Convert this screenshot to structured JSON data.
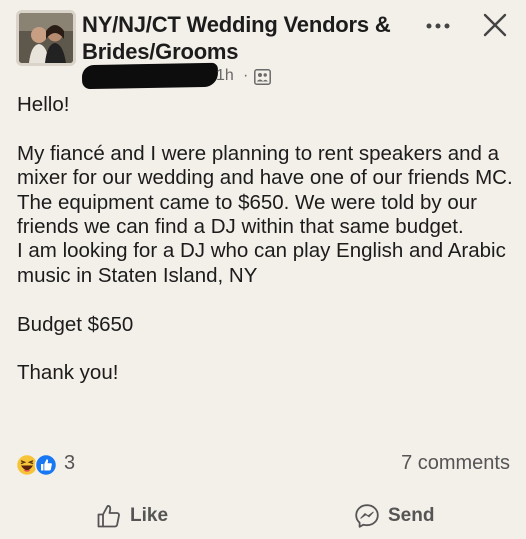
{
  "post": {
    "group_name": "NY/NJ/CT Wedding Vendors & Brides/Grooms",
    "time": "1h",
    "separator": "·",
    "audience_icon": "group-icon",
    "more_icon": "more-icon",
    "close_icon": "close-icon",
    "body": {
      "greeting": "Hello!",
      "paragraph": "My fiancé and I were planning to rent speakers and a mixer for our wedding and have one of our friends MC. The equipment came to $650. We were told by our friends we can find a DJ within that same budget.",
      "request": "I am looking for a DJ who can play English and Arabic music in Staten Island, NY",
      "budget": "Budget $650",
      "closing": "Thank you!"
    }
  },
  "engagement": {
    "reaction_icons": [
      "haha-reaction-icon",
      "like-reaction-icon"
    ],
    "reaction_count": "3",
    "comments": "7 comments"
  },
  "actions": {
    "like_label": "Like",
    "send_label": "Send"
  },
  "colors": {
    "background": "#f3efe9",
    "text": "#1c1c1c",
    "muted": "#555555",
    "like_blue": "#1877f2",
    "haha_yellow": "#f7c437"
  }
}
